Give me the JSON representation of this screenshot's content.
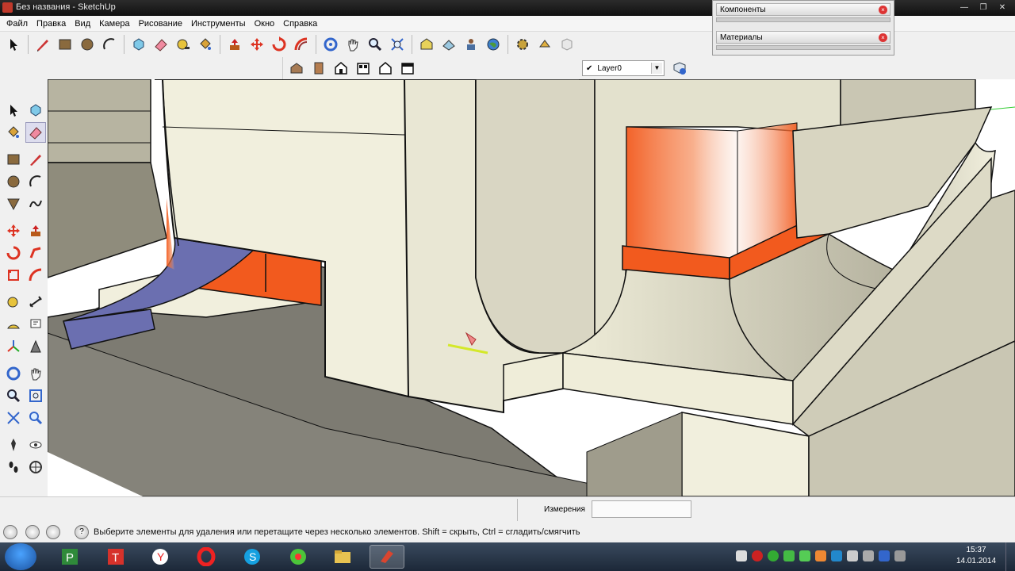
{
  "window": {
    "title": "Без названия - SketchUp"
  },
  "menu": [
    "Файл",
    "Правка",
    "Вид",
    "Камера",
    "Рисование",
    "Инструменты",
    "Окно",
    "Справка"
  ],
  "tray": {
    "components_title": "Компоненты",
    "materials_title": "Материалы"
  },
  "layer": {
    "current": "Layer0"
  },
  "measurements": {
    "label": "Измерения",
    "value": ""
  },
  "status": {
    "message": "Выберите элементы для удаления или перетащите через несколько элементов. Shift = скрыть, Ctrl = сгладить/смягчить",
    "help_glyph": "?"
  },
  "clock": {
    "time": "15:37",
    "date": "14.01.2014"
  },
  "colors": {
    "accent_orange": "#f25a1e",
    "purple_surface": "#6b6fb0",
    "cream_face": "#f1efdd",
    "shadow_gray": "#7d7b72"
  },
  "taskbar": {
    "apps": [
      "windows-explorer",
      "publisher",
      "text-app",
      "yandex-browser",
      "opera",
      "skype",
      "icq",
      "file-manager",
      "sketchup"
    ]
  }
}
